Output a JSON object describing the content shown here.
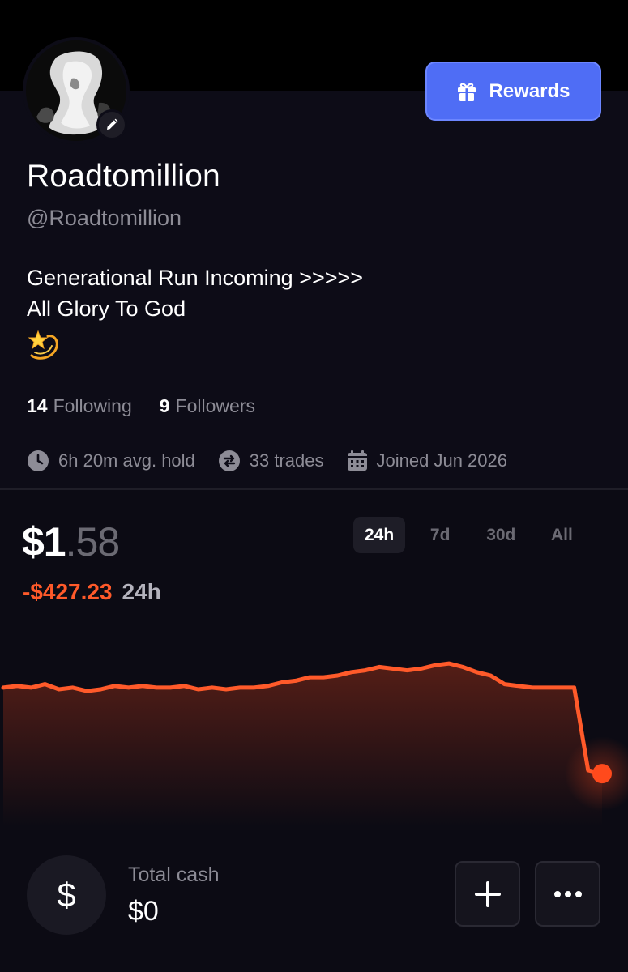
{
  "profile": {
    "display_name": "Roadtomillion",
    "handle": "@Roadtomillion",
    "bio_line1": "Generational Run Incoming >>>>>",
    "bio_line2": "All Glory To God",
    "bio_emoji": "dizzy-star-emoji"
  },
  "header": {
    "rewards_label": "Rewards",
    "rewards_color": "#4f6df5"
  },
  "stats": {
    "following_count": "14",
    "following_label": "Following",
    "followers_count": "9",
    "followers_label": "Followers"
  },
  "meta": {
    "avg_hold": "6h 20m avg. hold",
    "trades": "33 trades",
    "joined": "Joined Jun 2026"
  },
  "portfolio": {
    "balance_main": "$1",
    "balance_decimals": ".58",
    "change": "-$427.23",
    "change_period": "24h",
    "accent_color": "#ff5a2a"
  },
  "range_tabs": [
    {
      "label": "24h",
      "active": true
    },
    {
      "label": "7d",
      "active": false
    },
    {
      "label": "30d",
      "active": false
    },
    {
      "label": "All",
      "active": false
    }
  ],
  "chart_data": {
    "type": "line",
    "series": [
      {
        "values": [
          12,
          13,
          12,
          14,
          11,
          12,
          10,
          11,
          13,
          12,
          13,
          12,
          12,
          13,
          11,
          12,
          11,
          12,
          12,
          13,
          15,
          16,
          18,
          18,
          19,
          21,
          22,
          24,
          23,
          22,
          23,
          25,
          26,
          24,
          21,
          19,
          14,
          13,
          12,
          12,
          12,
          12,
          -36,
          -38
        ]
      }
    ]
  },
  "cash": {
    "label": "Total cash",
    "value": "$0",
    "icon": "$"
  },
  "actions": {
    "add_icon": "plus-icon",
    "more_icon": "more-icon"
  }
}
